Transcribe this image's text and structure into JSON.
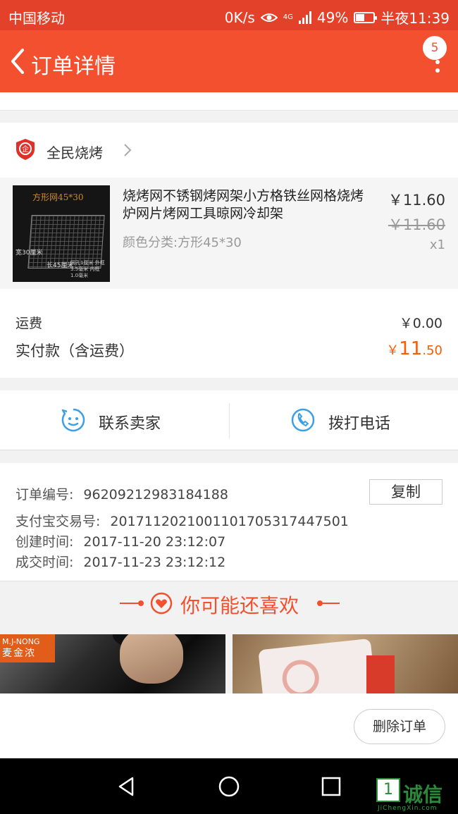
{
  "status_bar": {
    "carrier": "中国移动",
    "speed": "0K/s",
    "network": "4G",
    "battery": "49%",
    "battery_level": 0.49,
    "time": "半夜11:39"
  },
  "header": {
    "title": "订单详情",
    "badge_count": "5"
  },
  "shop": {
    "name": "全民烧烤"
  },
  "product": {
    "image_title": "方形网45*30",
    "image_label_width": "宽30厘米",
    "image_label_length": "长45厘米",
    "image_label_spec": "网孔1厘米 外框3.5毫米 内框1.0毫米",
    "title": "烧烤网不锈钢烤网架小方格铁丝网格烧烤炉网片烤网工具晾网冷却架",
    "sku": "颜色分类:方形45*30",
    "price": "￥11.60",
    "original_price": "￥11.60",
    "quantity": "x1"
  },
  "fees": {
    "shipping_label": "运费",
    "shipping_value": "￥0.00",
    "total_label": "实付款（含运费）",
    "total_currency": "￥",
    "total_int": "11",
    "total_dec": ".50"
  },
  "contact": {
    "seller_label": "联系卖家",
    "call_label": "拨打电话"
  },
  "order_info": {
    "order_no_label": "订单编号:",
    "order_no": "96209212983184188",
    "copy_label": "复制",
    "alipay_label": "支付宝交易号:",
    "alipay_no": "2017112021001101705317447501",
    "created_label": "创建时间:",
    "created": "2017-11-20 23:12:07",
    "closed_label": "成交时间:",
    "closed": "2017-11-23 23:12:12"
  },
  "recommend": {
    "title": "你可能还喜欢",
    "card1_brand_en": "M.J-NONG",
    "card1_brand_cn": "麦金浓"
  },
  "actions": {
    "delete_label": "删除订单"
  },
  "watermark": {
    "box_char": "1",
    "cn": "诚信",
    "en": "JiChengXin.com"
  },
  "colors": {
    "header": "#f2502f",
    "accent_price": "#f95b00",
    "icon_blue": "#3aa0e6"
  }
}
